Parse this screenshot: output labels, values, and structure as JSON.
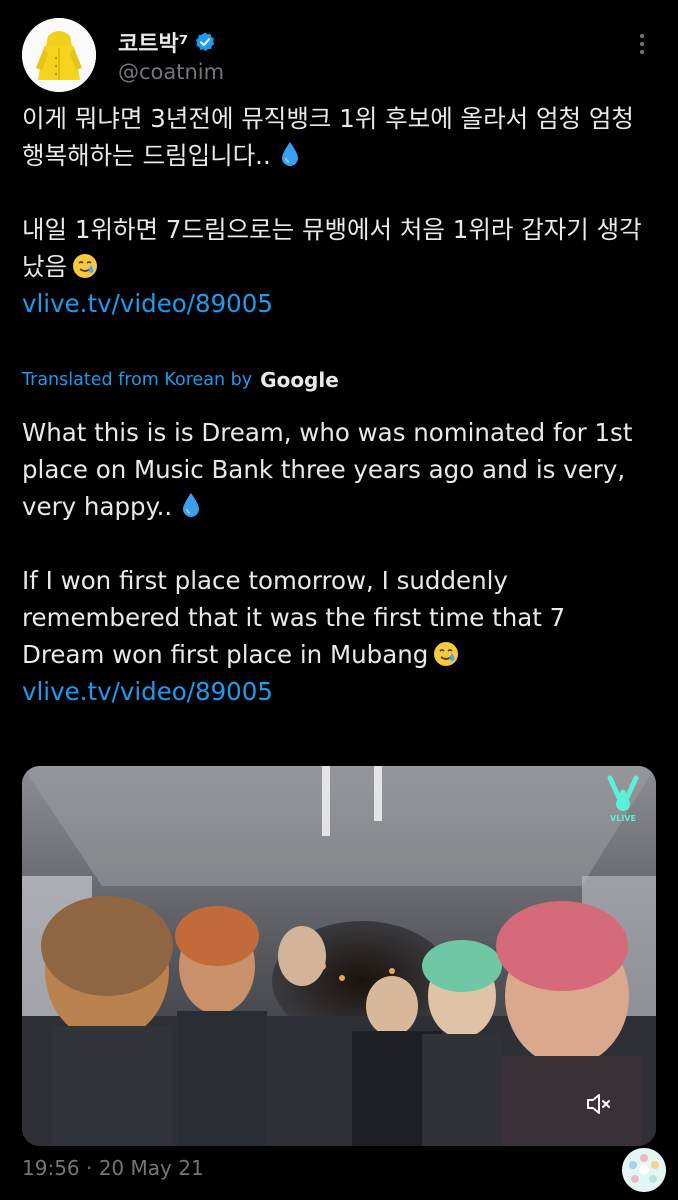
{
  "author": {
    "display_name": "코트박⁷",
    "handle": "@coatnim",
    "verified": true,
    "avatar_icon": "yellow-raincoat-avatar"
  },
  "tweet": {
    "korean": {
      "para1": "이게 뭐냐면 3년전에 뮤직뱅크 1위 후보에 올라서 엄청 엄청 행복해하는 드림입니다..",
      "para2": "내일 1위하면 7드림으로는 뮤뱅에서 처음 1위라 갑자기 생각났음",
      "link": "vlive.tv/video/89005"
    },
    "translation_note": "Translated from Korean by",
    "translation_provider": "Google",
    "english": {
      "para1": "What this is is Dream, who was nominated for 1st place on Music Bank three years ago and is very, very happy..",
      "para2": "If I won first place tomorrow, I suddenly remembered that it was the first time that 7 Dream won first place in Mubang",
      "link": "vlive.tv/video/89005"
    },
    "timestamp": "19:56 · 20 May 21"
  },
  "media": {
    "type": "video",
    "overlay_logo_text": "VLIVE",
    "muted": true
  },
  "colors": {
    "background": "#000000",
    "text": "#e7e9ea",
    "secondary": "#71767b",
    "link": "#1d9bf0",
    "verified": "#1d9bf0"
  }
}
